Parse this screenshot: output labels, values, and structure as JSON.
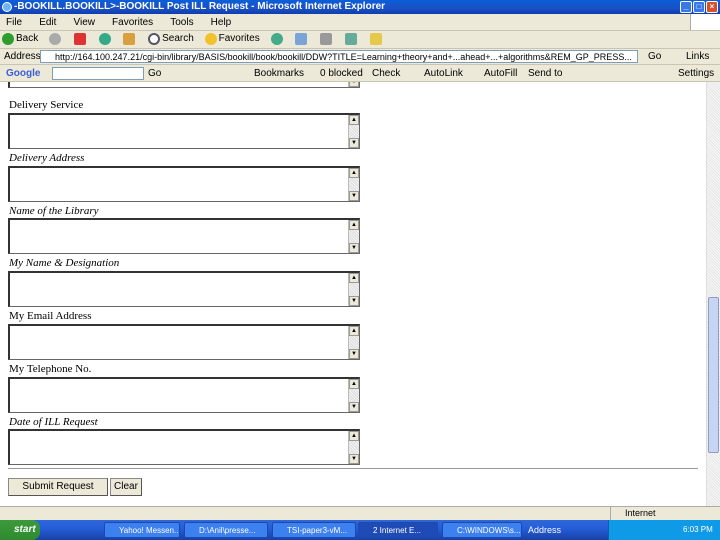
{
  "window": {
    "title": "-BOOKILL.BOOKILL>-BOOKILL Post ILL Request - Microsoft Internet Explorer"
  },
  "menu": [
    "File",
    "Edit",
    "View",
    "Favorites",
    "Tools",
    "Help"
  ],
  "toolbar": {
    "back": "Back",
    "search": "Search",
    "favorites": "Favorites"
  },
  "address": {
    "label": "Address",
    "url": "http://164.100.247.21/cgi-bin/library/BASIS/bookill/book/bookill/DDW?TITLE=Learning+theory+and+...ahead+...+algorithms&REM_GP_PRESS...",
    "go": "Go",
    "links": "Links"
  },
  "google": {
    "logo": "Google",
    "go": "Go",
    "bookmarks": "Bookmarks",
    "blocked": "0 blocked",
    "check": "Check",
    "autolink": "AutoLink",
    "autofill": "AutoFill",
    "sendto": "Send to",
    "settings": "Settings"
  },
  "form": {
    "fields": [
      {
        "label": "Delivery Service",
        "italic": false
      },
      {
        "label": "Delivery Address",
        "italic": true
      },
      {
        "label": "Name of the Library",
        "italic": true
      },
      {
        "label": "My Name & Designation",
        "italic": true
      },
      {
        "label": "My Email Address",
        "italic": false
      },
      {
        "label": "My Telephone No.",
        "italic": false
      },
      {
        "label": "Date of ILL Request",
        "italic": true
      }
    ],
    "submit": "Submit Request",
    "clear": "Clear"
  },
  "status": {
    "zone": "Internet"
  },
  "taskbar": {
    "start": "start",
    "tasks": [
      "Yahoo! Messen...",
      "D:\\Anil\\presse...",
      "TSI-paper3-vM...",
      "2 Internet E...",
      "C:\\WINDOWS\\s..."
    ],
    "address_label": "Address",
    "clock": "6:03 PM"
  }
}
